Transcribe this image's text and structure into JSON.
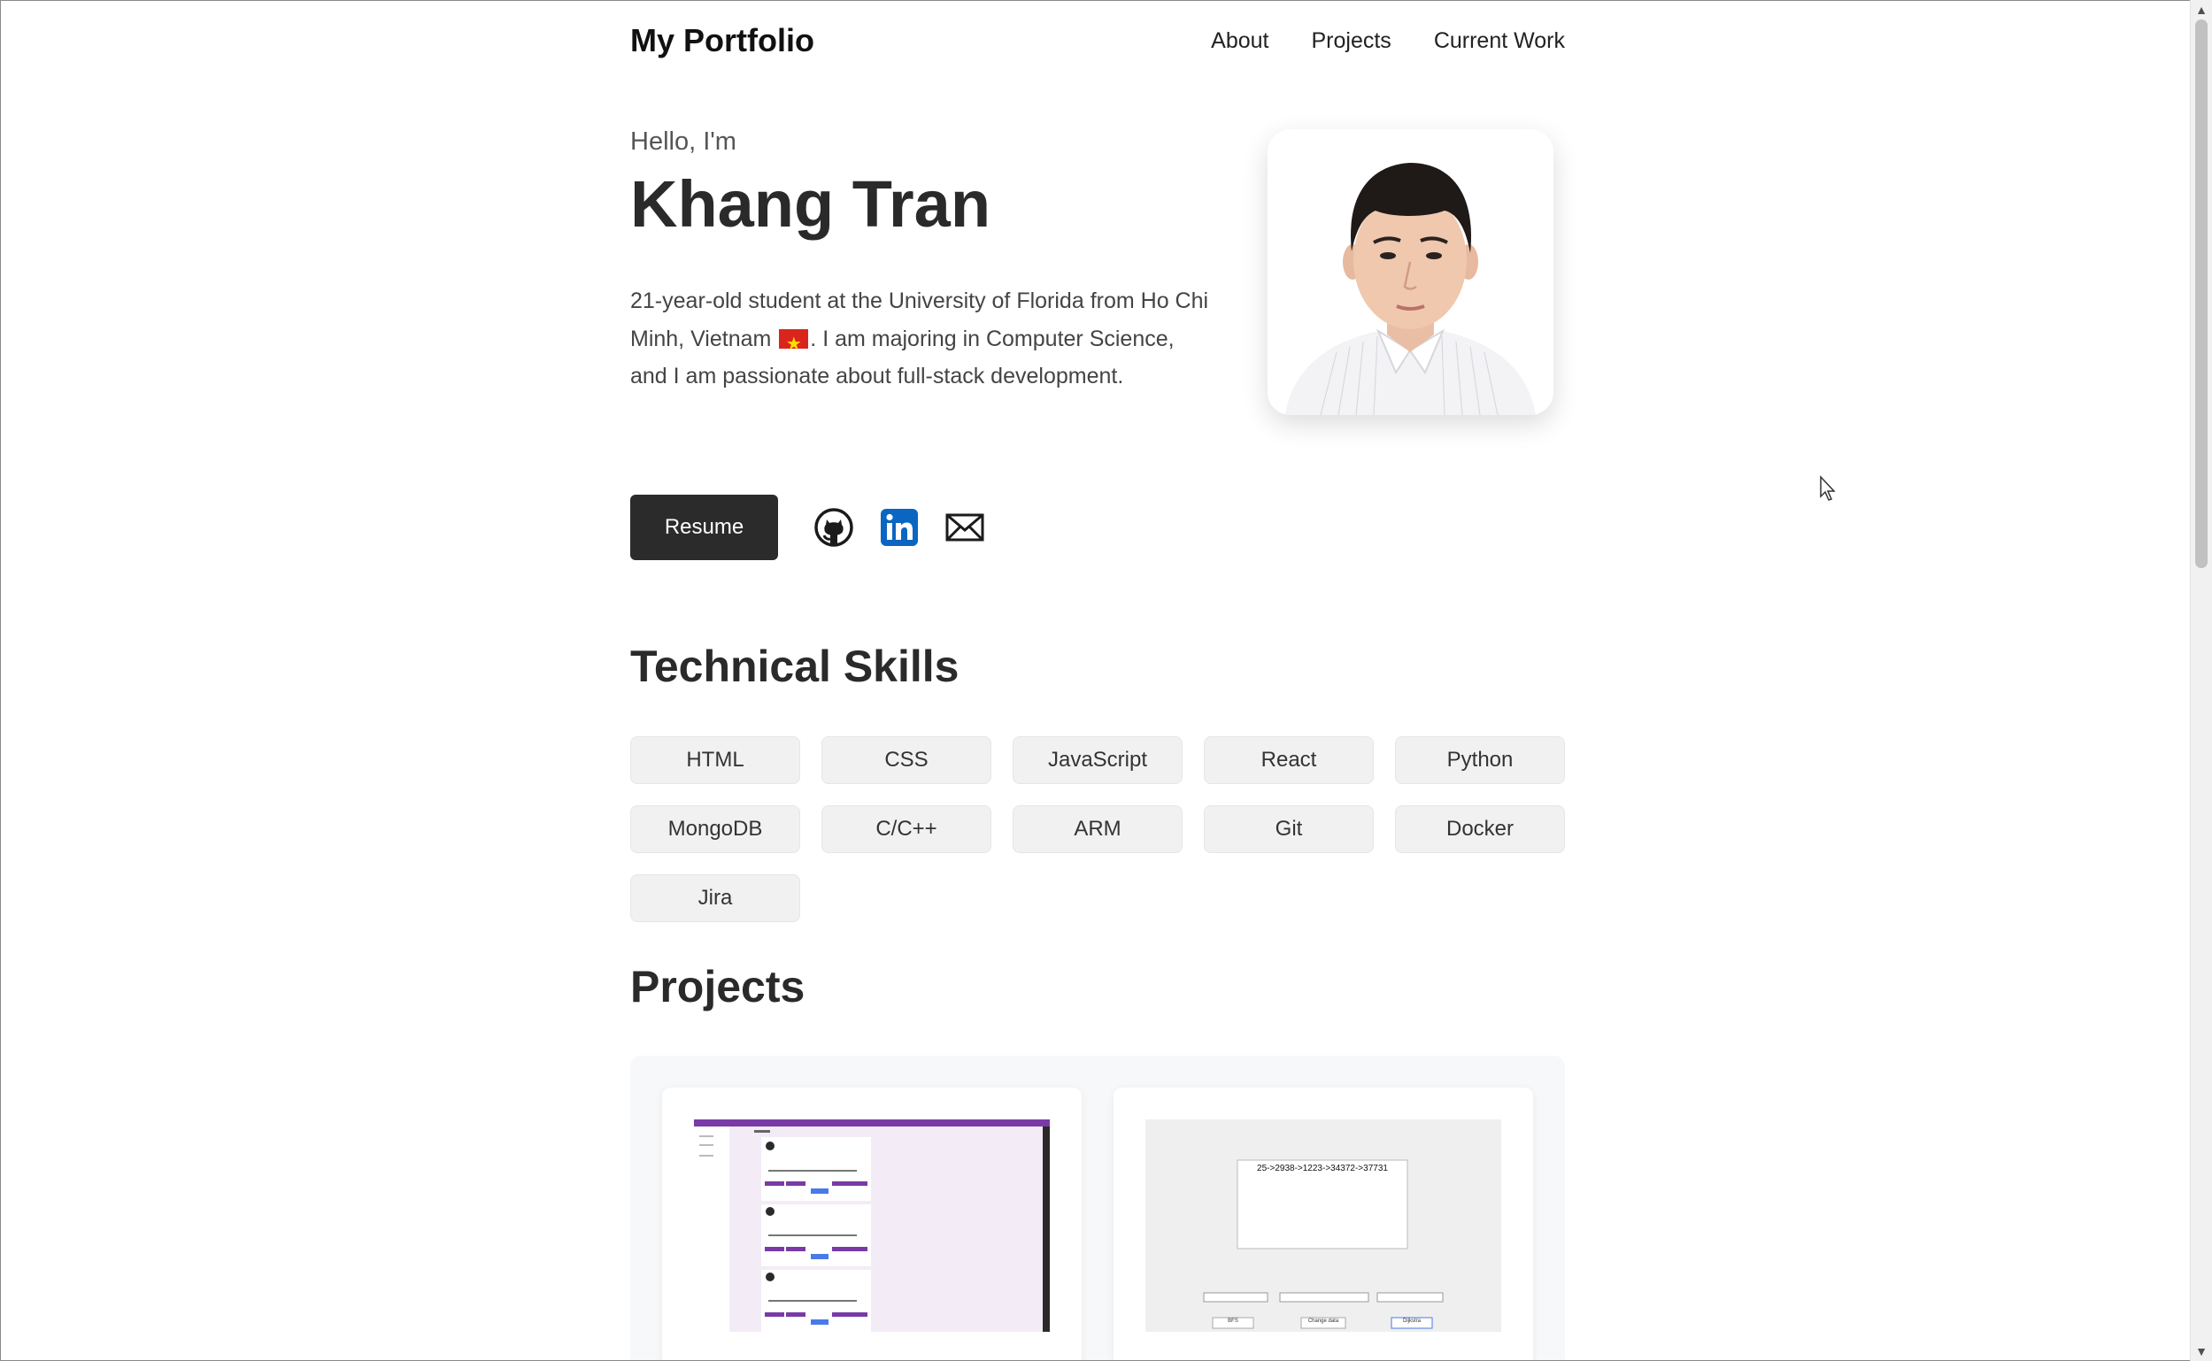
{
  "header": {
    "logo": "My Portfolio",
    "nav": [
      "About",
      "Projects",
      "Current Work"
    ]
  },
  "hero": {
    "greeting": "Hello, I'm",
    "name": "Khang Tran",
    "bio_before_flag": "21-year-old student at the University of Florida from Ho Chi Minh, Vietnam ",
    "bio_after_flag": ". I am majoring in Computer Science, and I am passionate about full-stack development.",
    "resume_label": "Resume"
  },
  "icons": {
    "github": "github-icon",
    "linkedin": "linkedin-icon",
    "email": "mail-icon"
  },
  "colors": {
    "linkedin": "#0a66c2",
    "button": "#2b2b2b",
    "skill_bg": "#f1f1f1",
    "flag_red": "#da251d",
    "flag_star": "#ffdd00"
  },
  "skills_section": {
    "title": "Technical Skills",
    "items": [
      "HTML",
      "CSS",
      "JavaScript",
      "React",
      "Python",
      "MongoDB",
      "C/C++",
      "ARM",
      "Git",
      "Docker",
      "Jira"
    ]
  },
  "projects_section": {
    "title": "Projects",
    "card2_text": "25->2938->1223->34372->37731",
    "card2_buttons": [
      "BFS",
      "Change data",
      "Dijkstra"
    ]
  }
}
